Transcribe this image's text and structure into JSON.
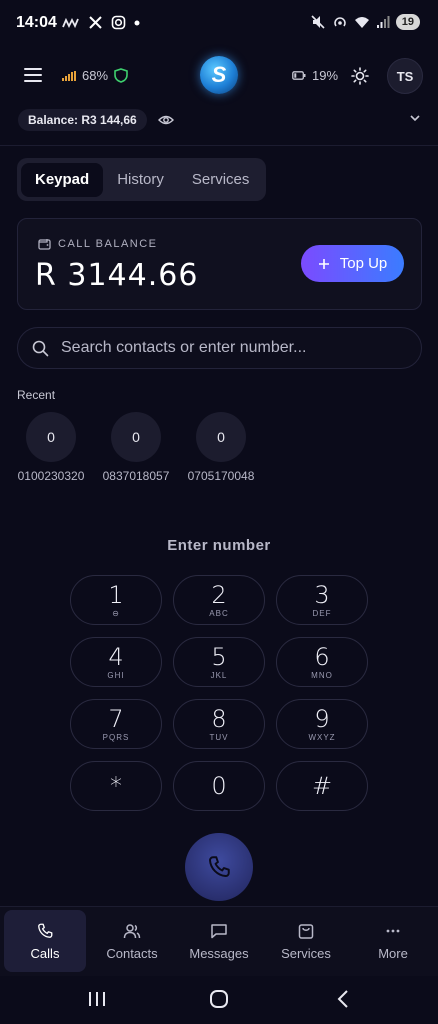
{
  "status_bar": {
    "time": "14:04",
    "battery": "19",
    "icons": [
      "mv-icon",
      "x-icon",
      "instagram-icon",
      "dot",
      "mute-icon",
      "hotspot-icon",
      "wifi-icon",
      "signal-icon"
    ]
  },
  "header": {
    "signal_pct": "68%",
    "battery_pct": "19%",
    "avatar_initials": "TS",
    "balance_pill": "Balance: R3 144,66"
  },
  "tabs": [
    {
      "label": "Keypad",
      "active": true
    },
    {
      "label": "History",
      "active": false
    },
    {
      "label": "Services",
      "active": false
    }
  ],
  "balance_card": {
    "label": "CALL BALANCE",
    "amount": "R 3144.66",
    "topup_label": "Top Up"
  },
  "search": {
    "placeholder": "Search contacts or enter number..."
  },
  "recent": {
    "label": "Recent",
    "items": [
      {
        "initial": "0",
        "number": "0100230320"
      },
      {
        "initial": "0",
        "number": "0837018057"
      },
      {
        "initial": "0",
        "number": "0705170048"
      }
    ]
  },
  "keypad": {
    "prompt": "Enter number",
    "keys": [
      {
        "digit": "1",
        "letters": "⊖"
      },
      {
        "digit": "2",
        "letters": "ABC"
      },
      {
        "digit": "3",
        "letters": "DEF"
      },
      {
        "digit": "4",
        "letters": "GHI"
      },
      {
        "digit": "5",
        "letters": "JKL"
      },
      {
        "digit": "6",
        "letters": "MNO"
      },
      {
        "digit": "7",
        "letters": "PQRS"
      },
      {
        "digit": "8",
        "letters": "TUV"
      },
      {
        "digit": "9",
        "letters": "WXYZ"
      },
      {
        "digit": "*",
        "letters": ""
      },
      {
        "digit": "0",
        "letters": ""
      },
      {
        "digit": "#",
        "letters": ""
      }
    ]
  },
  "bottom_nav": [
    {
      "label": "Calls",
      "icon": "phone-icon",
      "active": true
    },
    {
      "label": "Contacts",
      "icon": "contacts-icon",
      "active": false
    },
    {
      "label": "Messages",
      "icon": "message-icon",
      "active": false
    },
    {
      "label": "Services",
      "icon": "bag-icon",
      "active": false
    },
    {
      "label": "More",
      "icon": "more-icon",
      "active": false
    }
  ],
  "colors": {
    "background": "#0b0b1a",
    "accent_start": "#7b4bff",
    "accent_end": "#3b7cff",
    "shield_green": "#3ecf6e",
    "signal_orange": "#e8a23a"
  }
}
